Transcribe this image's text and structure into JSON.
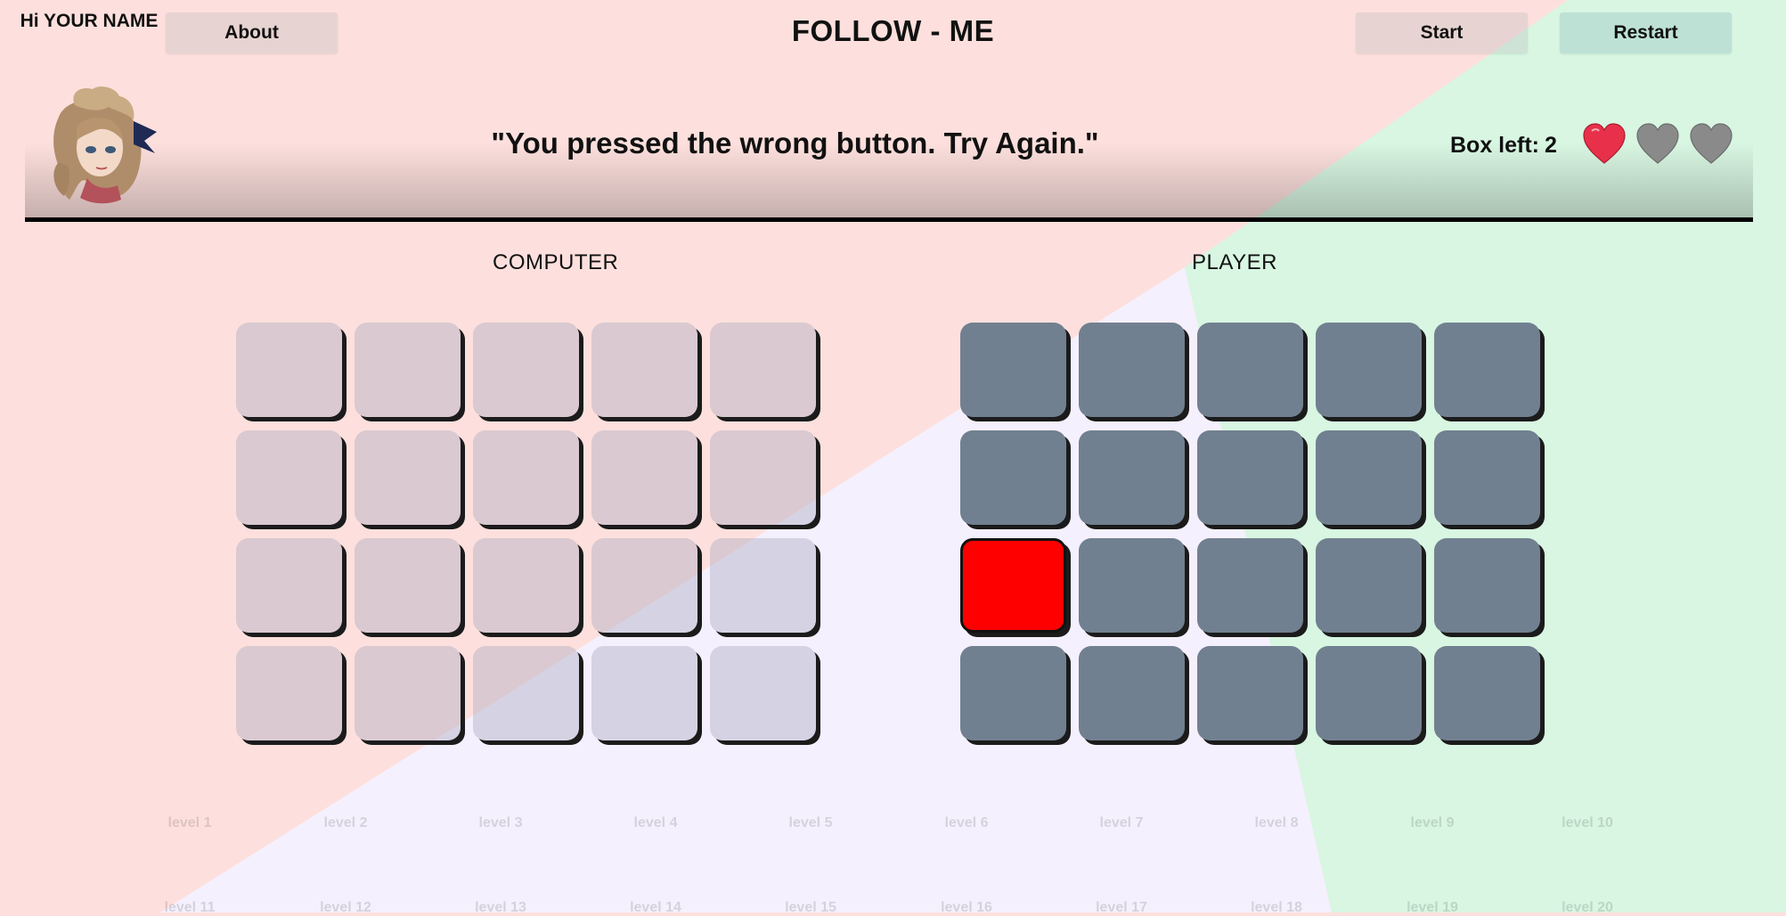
{
  "header": {
    "greeting": "Hi YOUR NAME",
    "about_label": "About",
    "title": "FOLLOW - ME",
    "start_label": "Start",
    "restart_label": "Restart"
  },
  "status": {
    "message": "\"You pressed the wrong button. Try Again.\"",
    "box_left_label": "Box left:",
    "box_left_value": "2",
    "lives_total": 3,
    "lives_remaining": 1,
    "heart_active_color": "#e8304a",
    "heart_lost_color": "#8a8a8a"
  },
  "computer": {
    "label": "COMPUTER",
    "rows": 4,
    "cols": 5
  },
  "player": {
    "label": "PLAYER",
    "rows": 4,
    "cols": 5,
    "tile_color": "#718090",
    "wrong_tile_color": "#ff0000",
    "wrong_tile": {
      "row": 3,
      "col": 1
    }
  },
  "levels": [
    "level 1",
    "level 2",
    "level 3",
    "level 4",
    "level 5",
    "level 6",
    "level 7",
    "level 8",
    "level 9",
    "level 10",
    "level 11",
    "level 12",
    "level 13",
    "level 14",
    "level 15",
    "level 16",
    "level 17",
    "level 18",
    "level 19",
    "level 20"
  ],
  "colors": {
    "bg_pink": "#fde0dd",
    "bg_lavender": "#f5f0fd",
    "bg_green": "#d8f6e2"
  }
}
